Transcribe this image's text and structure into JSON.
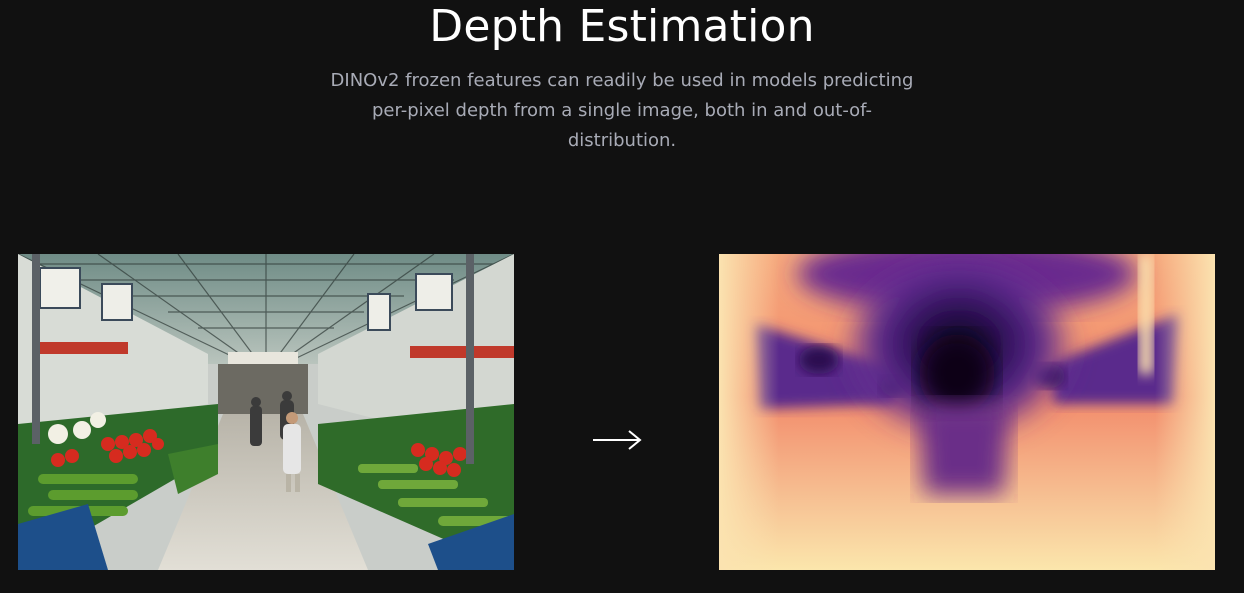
{
  "section": {
    "title": "Depth Estimation",
    "description": "DINOv2 frozen features can readily be used in models predicting per-pixel depth from a single image, both in and out-of-distribution."
  },
  "images": {
    "input": {
      "caption": ""
    },
    "output": {
      "caption": ""
    }
  },
  "icons": {
    "arrow": "arrow-right-icon"
  },
  "colors": {
    "background": "#111111",
    "title": "#ffffff",
    "subtitle": "#a8abb6",
    "arrow": "#ffffff"
  }
}
